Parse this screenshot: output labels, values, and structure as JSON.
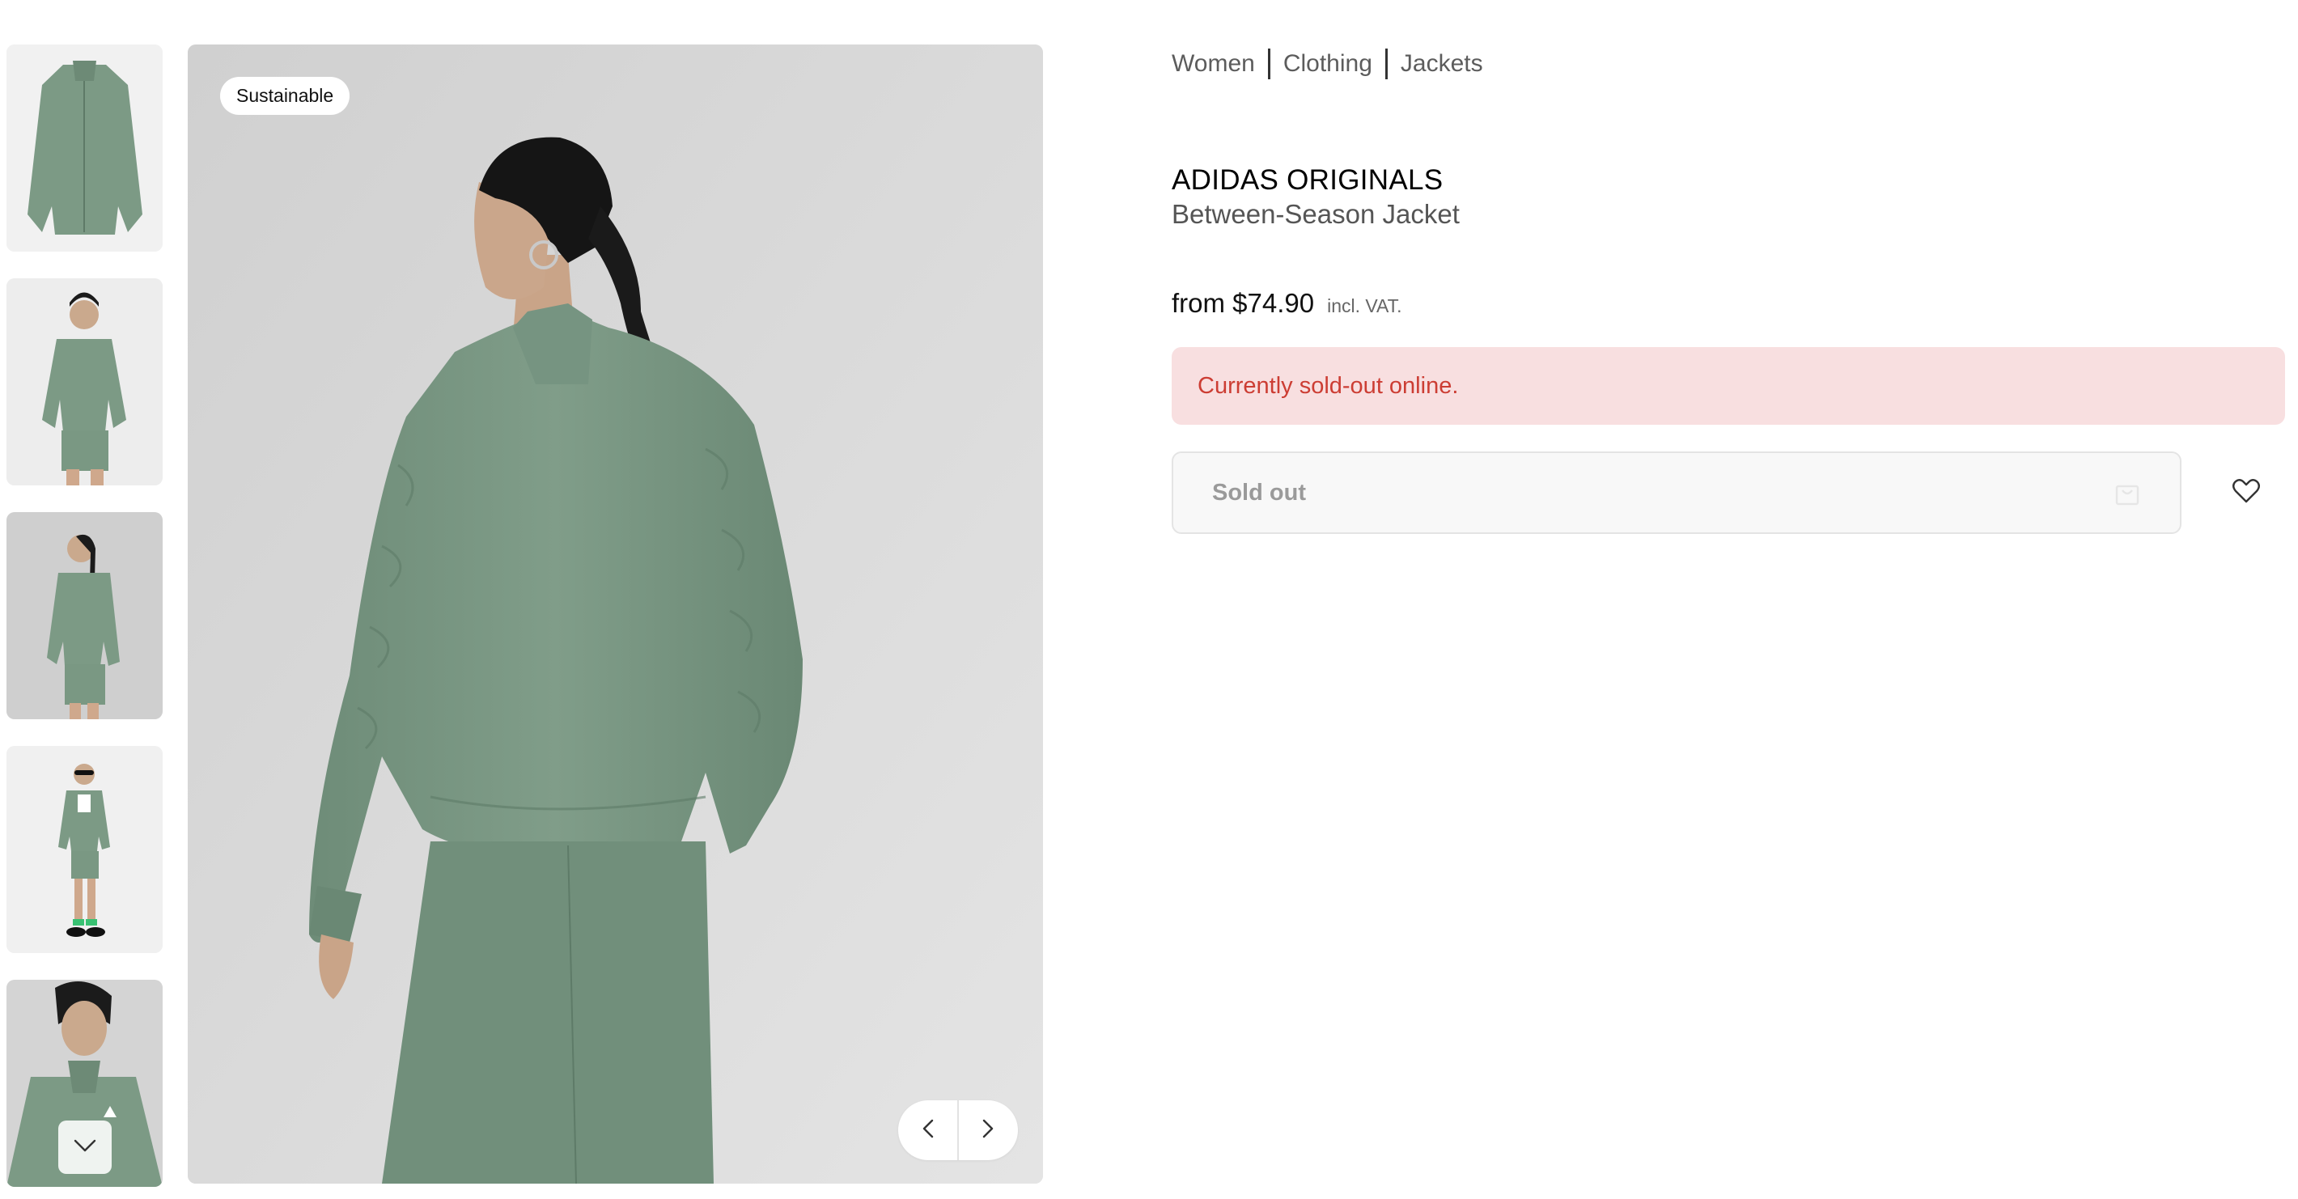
{
  "gallery": {
    "badge": "Sustainable",
    "thumbnails": [
      {
        "name": "jacket-flatlay"
      },
      {
        "name": "model-front"
      },
      {
        "name": "model-side"
      },
      {
        "name": "model-full-body"
      },
      {
        "name": "model-closeup"
      }
    ],
    "icons": {
      "prev": "chevron-left-icon",
      "next": "chevron-right-icon",
      "more": "chevron-down-icon"
    }
  },
  "breadcrumb": [
    "Women",
    "Clothing",
    "Jackets"
  ],
  "product": {
    "brand": "ADIDAS ORIGINALS",
    "name": "Between-Season Jacket",
    "price": "from $74.90",
    "vat_note": "incl. VAT."
  },
  "availability": {
    "alert": "Currently sold-out online.",
    "button_label": "Sold out"
  },
  "colors": {
    "jacket": "#7c9a85",
    "alert_bg": "#f8dfe0",
    "alert_text": "#cc3d33"
  }
}
